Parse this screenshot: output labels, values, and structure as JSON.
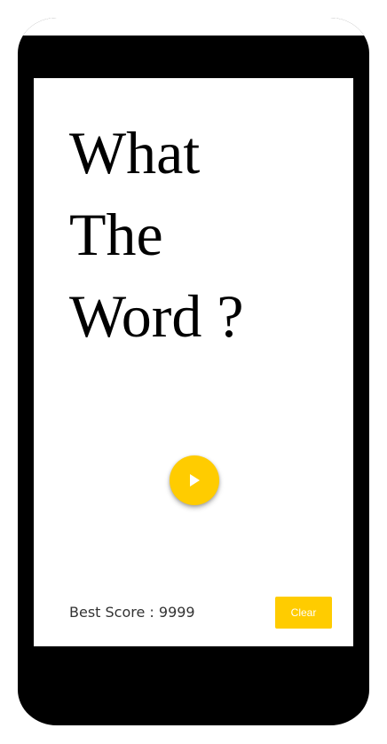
{
  "title": {
    "line1": "What",
    "line2": "The",
    "line3": "Word ?"
  },
  "play_button": {
    "icon": "play-icon"
  },
  "footer": {
    "best_score_label": "Best Score : ",
    "best_score_value": "9999",
    "clear_label": "Clear"
  },
  "colors": {
    "accent": "#ffcc00",
    "device": "#000000",
    "screen": "#ffffff",
    "text": "#000000"
  }
}
